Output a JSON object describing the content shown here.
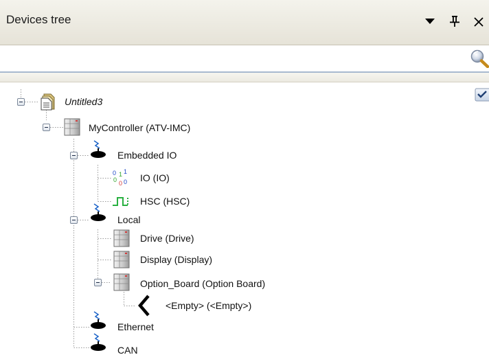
{
  "panel": {
    "title": "Devices tree"
  },
  "search": {
    "value": "",
    "placeholder": ""
  },
  "tree": {
    "root": "Untitled3",
    "controller": "MyController (ATV-IMC)",
    "embedded_io": "Embedded IO",
    "io": "IO (IO)",
    "hsc": "HSC (HSC)",
    "local": "Local",
    "drive": "Drive (Drive)",
    "display": "Display (Display)",
    "option_board": "Option_Board (Option Board)",
    "empty": "<Empty> (<Empty>)",
    "ethernet": "Ethernet",
    "can": "CAN",
    "io_digits": [
      "0",
      "1",
      "1",
      "0",
      "0",
      "0"
    ]
  },
  "icons": {
    "dropdown": "chevron-down-icon",
    "pin": "pin-icon",
    "close": "close-icon",
    "search": "search-icon",
    "project": "project-icon",
    "controller": "controller-icon",
    "bus": "bus-connector-icon",
    "io": "digital-io-icon",
    "hsc": "pulse-icon",
    "module": "module-icon",
    "slot": "empty-slot-icon",
    "check": "checkmark-icon"
  },
  "colors": {
    "bus_cable": "#1a62c8",
    "io_blue": "#1f47c6",
    "io_green": "#2fa52a",
    "hsc_green": "#28b040",
    "module_red": "#d43b3b"
  }
}
